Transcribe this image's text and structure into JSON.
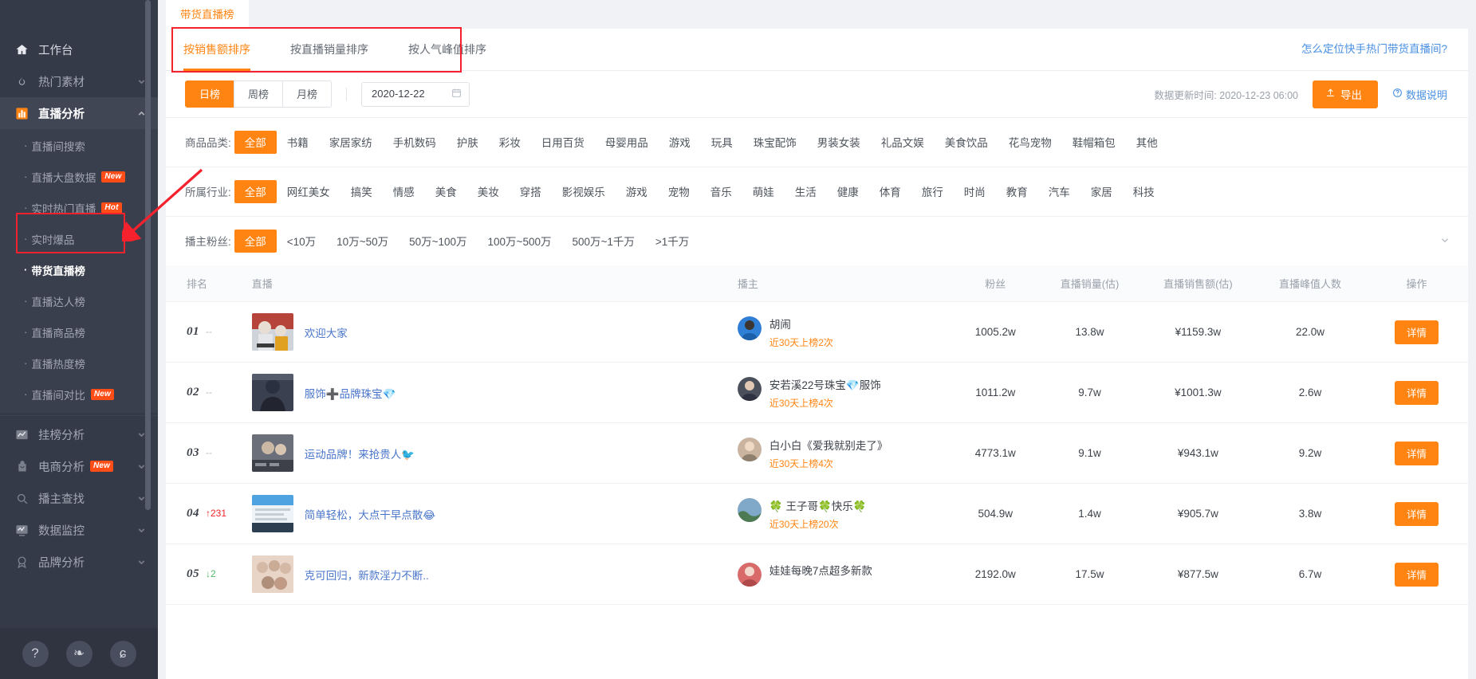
{
  "sidebar": {
    "groups": [
      {
        "icon": "home-icon",
        "label": "工作台",
        "state": "plain",
        "has_chevron": false
      },
      {
        "icon": "fire-icon",
        "label": "热门素材",
        "state": "dim",
        "has_chevron": true
      },
      {
        "icon": "chart-bars-icon",
        "label": "直播分析",
        "state": "active",
        "has_chevron": true
      }
    ],
    "live_items": [
      {
        "label": "直播间搜索",
        "tag": "",
        "selected": false
      },
      {
        "label": "直播大盘数据",
        "tag": "New",
        "selected": false
      },
      {
        "label": "实时热门直播",
        "tag": "Hot",
        "selected": false
      },
      {
        "label": "实时爆品",
        "tag": "",
        "selected": false
      },
      {
        "label": "带货直播榜",
        "tag": "",
        "selected": true
      },
      {
        "label": "直播达人榜",
        "tag": "",
        "selected": false
      },
      {
        "label": "直播商品榜",
        "tag": "",
        "selected": false
      },
      {
        "label": "直播热度榜",
        "tag": "",
        "selected": false
      },
      {
        "label": "直播间对比",
        "tag": "New",
        "selected": false
      }
    ],
    "lower_groups": [
      {
        "icon": "trend-icon",
        "label": "挂榜分析",
        "tag": "",
        "has_chevron": true
      },
      {
        "icon": "bag-icon",
        "label": "电商分析",
        "tag": "New",
        "has_chevron": true
      },
      {
        "icon": "search-icon",
        "label": "播主查找",
        "tag": "",
        "has_chevron": true
      },
      {
        "icon": "monitor-icon",
        "label": "数据监控",
        "tag": "",
        "has_chevron": true
      },
      {
        "icon": "badge-icon",
        "label": "品牌分析",
        "tag": "",
        "has_chevron": true
      }
    ],
    "footer_icons": [
      {
        "name": "help-icon",
        "glyph": "?"
      },
      {
        "name": "wechat-icon",
        "glyph": "❧"
      },
      {
        "name": "mini-program-icon",
        "glyph": "ɕ"
      }
    ]
  },
  "page_tab": {
    "label": "带货直播榜"
  },
  "sort_tabs": [
    {
      "label": "按销售额排序",
      "active": true
    },
    {
      "label": "按直播销量排序",
      "active": false
    },
    {
      "label": "按人气峰值排序",
      "active": false
    }
  ],
  "help_link": "怎么定位快手热门带货直播间?",
  "period": {
    "options": [
      {
        "label": "日榜",
        "on": true
      },
      {
        "label": "周榜",
        "on": false
      },
      {
        "label": "月榜",
        "on": false
      }
    ],
    "date_value": "2020-12-22",
    "updated_label": "数据更新时间: 2020-12-23 06:00",
    "export_label": "导出",
    "data_desc_label": "数据说明"
  },
  "filters": [
    {
      "label": "商品品类:",
      "options": [
        "全部",
        "书籍",
        "家居家纺",
        "手机数码",
        "护肤",
        "彩妆",
        "日用百货",
        "母婴用品",
        "游戏",
        "玩具",
        "珠宝配饰",
        "男装女装",
        "礼品文娱",
        "美食饮品",
        "花鸟宠物",
        "鞋帽箱包",
        "其他"
      ],
      "selected": "全部",
      "expandable": false
    },
    {
      "label": "所属行业:",
      "options": [
        "全部",
        "网红美女",
        "搞笑",
        "情感",
        "美食",
        "美妆",
        "穿搭",
        "影视娱乐",
        "游戏",
        "宠物",
        "音乐",
        "萌娃",
        "生活",
        "健康",
        "体育",
        "旅行",
        "时尚",
        "教育",
        "汽车",
        "家居",
        "科技"
      ],
      "selected": "全部",
      "expandable": false
    },
    {
      "label": "播主粉丝:",
      "options": [
        "全部",
        "<10万",
        "10万~50万",
        "50万~100万",
        "100万~500万",
        "500万~1千万",
        ">1千万"
      ],
      "selected": "全部",
      "expandable": true
    }
  ],
  "table": {
    "headers": [
      "排名",
      "直播",
      "播主",
      "粉丝",
      "直播销量(估)",
      "直播销售额(估)",
      "直播峰值人数",
      "操作"
    ],
    "action_label": "详情",
    "rows": [
      {
        "rank": "01",
        "delta": "--",
        "delta_dir": "none",
        "title": "欢迎大家",
        "thumb_colors": [
          "#b6443a",
          "#d9d2cc",
          "#e0a020"
        ],
        "host": "胡闹",
        "host_badge": "近30天上榜2次",
        "avatar_colors": [
          "#2f7fd6",
          "#1a5fa8"
        ],
        "fans": "1005.2w",
        "sales": "13.8w",
        "amount": "¥1159.3w",
        "peak": "22.0w"
      },
      {
        "rank": "02",
        "delta": "--",
        "delta_dir": "none",
        "title": "服饰➕品牌珠宝💎",
        "thumb_colors": [
          "#2b3040",
          "#555b6b",
          "#8a8f9c"
        ],
        "host": "安若溪22号珠宝💎服饰",
        "host_badge": "近30天上榜4次",
        "avatar_colors": [
          "#4a4f5c",
          "#2d3140"
        ],
        "fans": "1011.2w",
        "sales": "9.7w",
        "amount": "¥1001.3w",
        "peak": "2.6w"
      },
      {
        "rank": "03",
        "delta": "--",
        "delta_dir": "none",
        "title": "运动品牌！来抢贵人🐦",
        "thumb_colors": [
          "#6a6f7a",
          "#c0b6ab",
          "#3d4049"
        ],
        "host": "白小白《爱我就别走了》",
        "host_badge": "近30天上榜4次",
        "avatar_colors": [
          "#cbb49f",
          "#8f7f6d"
        ],
        "fans": "4773.1w",
        "sales": "9.1w",
        "amount": "¥943.1w",
        "peak": "9.2w"
      },
      {
        "rank": "04",
        "delta": "↑231",
        "delta_dir": "up",
        "title": "简单轻松，大点干早点散😂",
        "thumb_colors": [
          "#4ea3e0",
          "#e8eef3",
          "#2c3e50"
        ],
        "host": "🍀 王子哥🍀快乐🍀",
        "host_badge": "近30天上榜20次",
        "avatar_colors": [
          "#7fa8c9",
          "#4d7a52"
        ],
        "fans": "504.9w",
        "sales": "1.4w",
        "amount": "¥905.7w",
        "peak": "3.8w"
      },
      {
        "rank": "05",
        "delta": "↓2",
        "delta_dir": "down",
        "title": "克可回归，新款淫力不断..",
        "thumb_colors": [
          "#d3b9a6",
          "#e8d5c8",
          "#b08f7a"
        ],
        "host": "娃娃每晚7点超多新款",
        "host_badge": "",
        "avatar_colors": [
          "#d96a6a",
          "#b04a4a"
        ],
        "fans": "2192.0w",
        "sales": "17.5w",
        "amount": "¥877.5w",
        "peak": "6.7w"
      }
    ]
  },
  "colors": {
    "accent": "#ff8412",
    "link": "#4a76c9",
    "help_link": "#4a90e2",
    "annotation": "#f5222d",
    "sidebar_bg": "#353a48",
    "sidebar_sub_bg": "#3a3f4d"
  }
}
